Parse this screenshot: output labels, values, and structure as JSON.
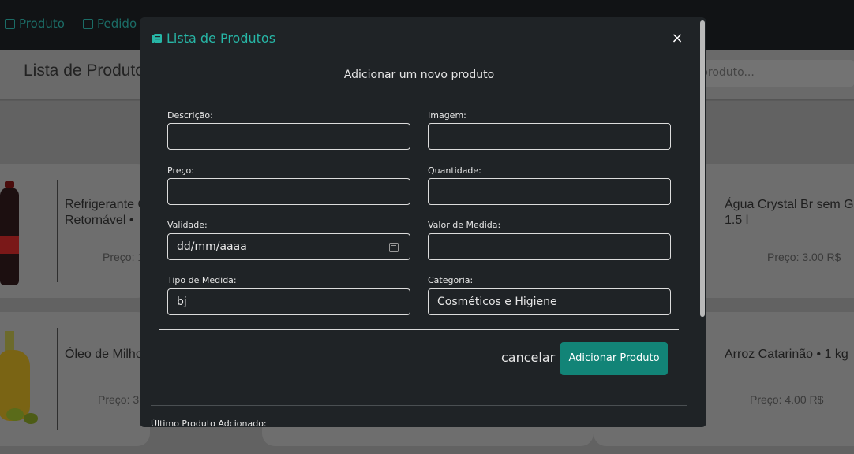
{
  "nav": {
    "items": [
      {
        "label": "Produto",
        "icon": "box-icon"
      },
      {
        "label": "Pedido",
        "icon": "list-icon"
      }
    ]
  },
  "background": {
    "page_title": "Lista de Produto",
    "search_placeholder": "produto...",
    "cards": [
      {
        "name": "Refrigerante C\nRetornável •",
        "price": "Preço: 1"
      },
      {
        "name": "Água Crystal Br sem G\n1.5 l",
        "price": "Preço: 3.00 R$"
      },
      {
        "name": "Óleo de Milho",
        "price": "Preço: 3"
      },
      {
        "name": "Arroz Catarinão • 1 kg",
        "price": "Preço: 4.00 R$"
      }
    ]
  },
  "modal": {
    "title": "Lista de Produtos",
    "title_icon": "list-book-icon",
    "close_label": "×",
    "subtitle": "Adicionar um novo produto",
    "fields": {
      "descricao": {
        "label": "Descrição:",
        "value": ""
      },
      "imagem": {
        "label": "Imagem:",
        "value": ""
      },
      "preco": {
        "label": "Preço:",
        "value": ""
      },
      "quantidade": {
        "label": "Quantidade:",
        "value": ""
      },
      "validade": {
        "label": "Validade:",
        "value": "dd/mm/aaaa"
      },
      "valor_medida": {
        "label": "Valor de Medida:",
        "value": ""
      },
      "tipo_medida": {
        "label": "Tipo de Medida:",
        "value": "bj"
      },
      "categoria": {
        "label": "Categoria:",
        "value": "Cosméticos e Higiene"
      }
    },
    "cancel_label": "cancelar",
    "add_label": "Adicionar Produto",
    "last_added_label": "Último Produto Adcionado:"
  },
  "colors": {
    "accent": "#27b6a6",
    "button": "#128477",
    "modal_bg": "#1f2326"
  }
}
